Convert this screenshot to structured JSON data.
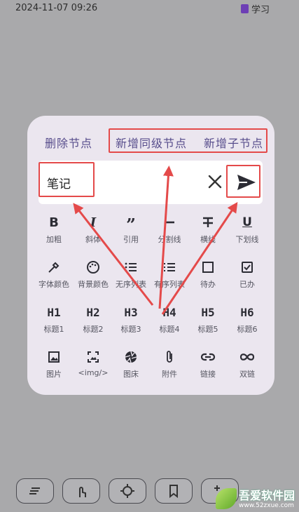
{
  "status": {
    "time": "2024-11-07 09:26",
    "right_label": "学习"
  },
  "popup": {
    "actions": {
      "delete": "删除节点",
      "add_sibling": "新增同级节点",
      "add_child": "新增子节点"
    },
    "input_value": "笔记",
    "tools": [
      {
        "icon": "B",
        "label": "加粗"
      },
      {
        "icon": "I",
        "label": "斜体"
      },
      {
        "icon": "quote",
        "label": "引用"
      },
      {
        "icon": "divider",
        "label": "分割线"
      },
      {
        "icon": "strikethrough",
        "label": "横线"
      },
      {
        "icon": "U",
        "label": "下划线"
      },
      {
        "icon": "dropper",
        "label": "字体颜色"
      },
      {
        "icon": "palette",
        "label": "背景颜色"
      },
      {
        "icon": "bullet-list",
        "label": "无序列表"
      },
      {
        "icon": "number-list",
        "label": "有序列表"
      },
      {
        "icon": "checkbox-empty",
        "label": "待办"
      },
      {
        "icon": "checkbox-checked",
        "label": "已办"
      },
      {
        "icon": "H1",
        "label": "标题1"
      },
      {
        "icon": "H2",
        "label": "标题2"
      },
      {
        "icon": "H3",
        "label": "标题3"
      },
      {
        "icon": "H4",
        "label": "标题4"
      },
      {
        "icon": "H5",
        "label": "标题5"
      },
      {
        "icon": "H6",
        "label": "标题6"
      },
      {
        "icon": "image",
        "label": "图片"
      },
      {
        "icon": "img-tag",
        "label": "<img/>"
      },
      {
        "icon": "aperture",
        "label": "图床"
      },
      {
        "icon": "paperclip",
        "label": "附件"
      },
      {
        "icon": "link",
        "label": "链接"
      },
      {
        "icon": "double-link",
        "label": "双链"
      }
    ]
  },
  "watermark": {
    "name": "吾爱软件园",
    "url": "www.52zxue.com"
  },
  "colors": {
    "accent": "#574d8c",
    "highlight": "#e44a4a",
    "popup_bg": "#ebe6ef"
  }
}
